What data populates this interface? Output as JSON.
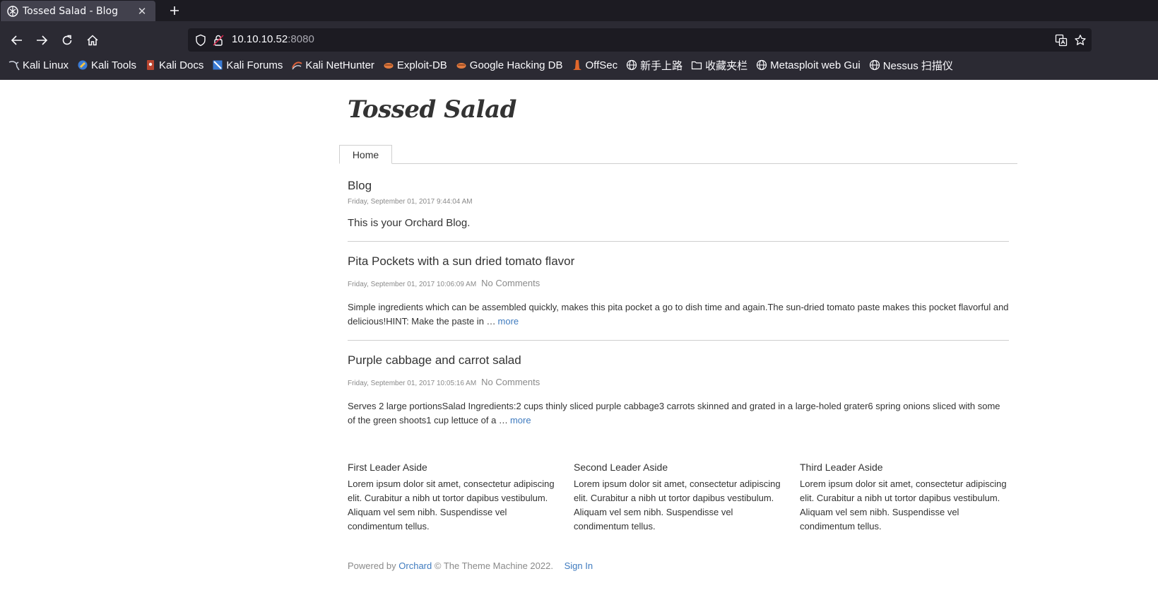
{
  "browser": {
    "tab_title": "Tossed Salad - Blog",
    "url_host": "10.10.10.52",
    "url_port": ":8080",
    "bookmarks": [
      {
        "label": "Kali Linux",
        "icon": "kali-dragon-icon"
      },
      {
        "label": "Kali Tools",
        "icon": "kali-tools-icon"
      },
      {
        "label": "Kali Docs",
        "icon": "kali-docs-icon"
      },
      {
        "label": "Kali Forums",
        "icon": "kali-forums-icon"
      },
      {
        "label": "Kali NetHunter",
        "icon": "kali-nethunter-icon"
      },
      {
        "label": "Exploit-DB",
        "icon": "exploit-db-icon"
      },
      {
        "label": "Google Hacking DB",
        "icon": "ghdb-icon"
      },
      {
        "label": "OffSec",
        "icon": "offsec-icon"
      },
      {
        "label": "新手上路",
        "icon": "globe-icon"
      },
      {
        "label": "收藏夹栏",
        "icon": "folder-icon"
      },
      {
        "label": "Metasploit web Gui",
        "icon": "globe-icon"
      },
      {
        "label": "Nessus 扫描仪",
        "icon": "globe-icon"
      }
    ]
  },
  "site": {
    "title": "Tossed Salad",
    "menu": [
      {
        "label": "Home"
      }
    ]
  },
  "blog": {
    "title": "Blog",
    "date": "Friday, September 01, 2017 9:44:04 AM",
    "description": "This is your Orchard Blog."
  },
  "posts": [
    {
      "title": "Pita Pockets with a sun dried tomato flavor",
      "date": "Friday, September 01, 2017 10:06:09 AM",
      "comments": "No Comments",
      "summary": "Simple ingredients which can be assembled quickly, makes this pita pocket a go to dish time and again.The sun-dried tomato paste makes this pocket flavorful and delicious!HINT:  Make the paste in …",
      "more": "more"
    },
    {
      "title": "Purple cabbage and carrot salad",
      "date": "Friday, September 01, 2017 10:05:16 AM",
      "comments": "No Comments",
      "summary": "Serves 2 large portionsSalad Ingredients:2 cups thinly sliced purple cabbage3 carrots skinned and grated in a large-holed grater6 spring onions sliced with some of the green shoots1 cup lettuce of a …",
      "more": "more"
    }
  ],
  "asides": [
    {
      "title": "First Leader Aside",
      "text": "Lorem ipsum dolor sit amet, consectetur adipiscing elit. Curabitur a nibh ut tortor dapibus vestibulum. Aliquam vel sem nibh. Suspendisse vel condimentum tellus."
    },
    {
      "title": "Second Leader Aside",
      "text": "Lorem ipsum dolor sit amet, consectetur adipiscing elit. Curabitur a nibh ut tortor dapibus vestibulum. Aliquam vel sem nibh. Suspendisse vel condimentum tellus."
    },
    {
      "title": "Third Leader Aside",
      "text": "Lorem ipsum dolor sit amet, consectetur adipiscing elit. Curabitur a nibh ut tortor dapibus vestibulum. Aliquam vel sem nibh. Suspendisse vel condimentum tellus."
    }
  ],
  "footer": {
    "powered_by": "Powered by",
    "orchard": "Orchard",
    "copyright": "© The Theme Machine 2022.",
    "sign_in": "Sign In"
  },
  "colors": {
    "chrome_dark": "#1c1b22",
    "chrome_toolbar": "#2b2a33",
    "link": "#3f7bbf"
  }
}
